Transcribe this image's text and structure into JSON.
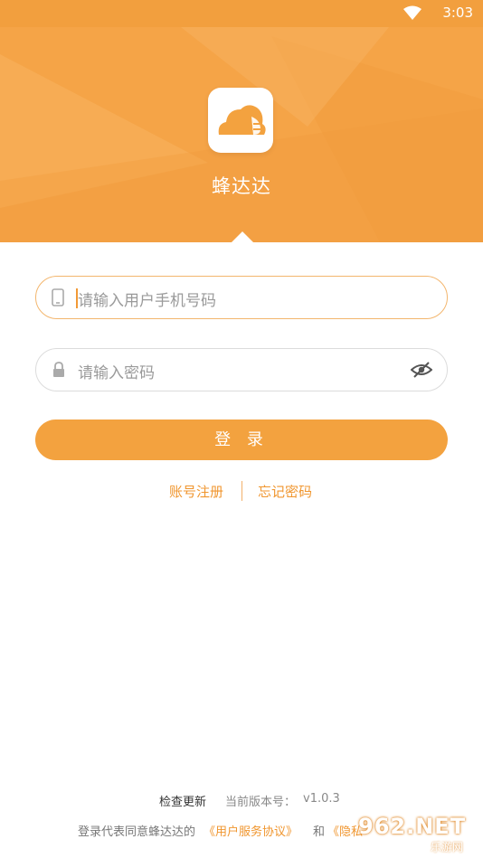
{
  "status_bar": {
    "time": "3:03"
  },
  "header": {
    "app_name": "蜂达达",
    "background_color": "#f5a447"
  },
  "login_form": {
    "phone_placeholder": "请输入用户手机号码",
    "password_placeholder": "请输入密码",
    "login_label": "登 录",
    "register_link": "账号注册",
    "forgot_link": "忘记密码"
  },
  "footer": {
    "check_update": "检查更新",
    "version_label": "当前版本号：",
    "version": "v1.0.3",
    "agreement_prefix": "登录代表同意蜂达达的",
    "user_agreement": "《用户服务协议》",
    "and": "和",
    "privacy_policy": "《隐私"
  },
  "watermark": {
    "brand": "962.NET",
    "sub": "乐游网"
  },
  "colors": {
    "accent": "#f3a23f",
    "link": "#f0962f"
  },
  "icons": [
    "wifi-icon",
    "app-logo-icon",
    "phone-icon",
    "lock-icon",
    "eye-off-icon"
  ]
}
